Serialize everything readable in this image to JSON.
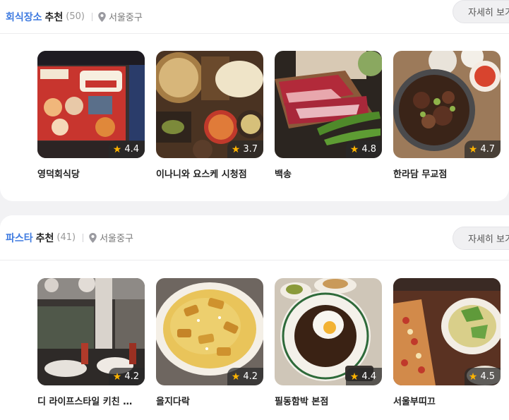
{
  "sections": [
    {
      "keyword": "회식장소",
      "suffix": "추천",
      "count": "(50)",
      "location": "서울중구",
      "more_label": "자세히 보기",
      "cards": [
        {
          "name": "영덕회식당",
          "rating": "4.4"
        },
        {
          "name": "이나니와 요스케 시청점",
          "rating": "3.7"
        },
        {
          "name": "백송",
          "rating": "4.8"
        },
        {
          "name": "한라담 무교점",
          "rating": "4.7"
        }
      ]
    },
    {
      "keyword": "파스타",
      "suffix": "추천",
      "count": "(41)",
      "location": "서울중구",
      "more_label": "자세히 보기",
      "cards": [
        {
          "name": "디 라이프스타일 키친 …",
          "rating": "4.2"
        },
        {
          "name": "을지다락",
          "rating": "4.2"
        },
        {
          "name": "필동함박 본점",
          "rating": "4.4"
        },
        {
          "name": "서울부띠끄",
          "rating": "4.5"
        }
      ]
    }
  ],
  "colors": {
    "accent": "#3f7be0",
    "star": "#ffb400"
  }
}
